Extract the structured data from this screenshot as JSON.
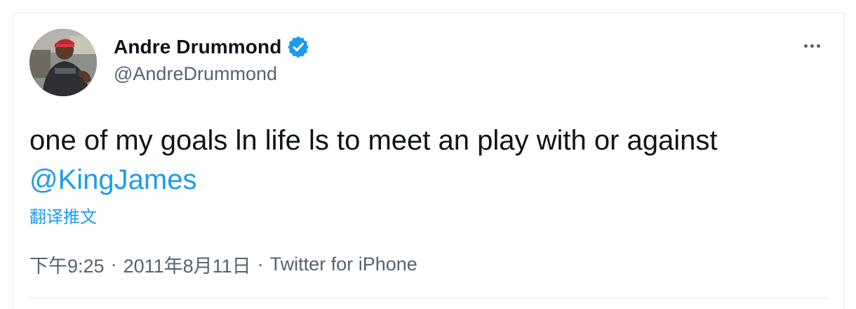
{
  "tweet": {
    "author": {
      "display_name": "Andre Drummond",
      "handle": "@AndreDrummond",
      "verified": true,
      "avatar_icon": "profile-photo"
    },
    "more_icon": "more-horizontal-icon",
    "text": "one of my goals ln life ls to meet an play with or against",
    "mention": "@KingJames",
    "translate_label": "翻译推文",
    "time": "下午9:25",
    "separator": "·",
    "date": "2011年8月11日",
    "source": "Twitter for iPhone"
  },
  "colors": {
    "text_primary": "#0f1419",
    "text_secondary": "#536471",
    "link": "#1d9bf0",
    "border": "#e7ebee"
  }
}
